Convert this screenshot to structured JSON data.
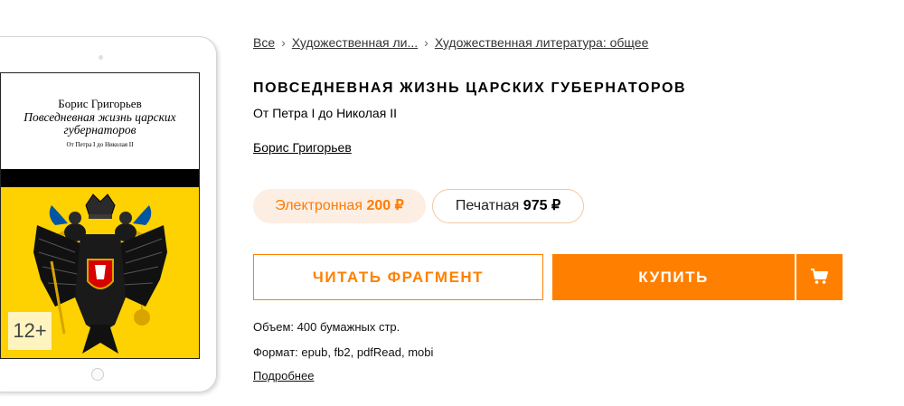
{
  "cover": {
    "author": "Борис Григорьев",
    "title": "Повседневная жизнь царских губернаторов",
    "subtitle": "От Петра I до Николая II",
    "age_rating": "12+",
    "colors": {
      "band": "#000000",
      "background": "#fed100"
    }
  },
  "breadcrumb": [
    {
      "label": "Все"
    },
    {
      "label": "Художественная ли..."
    },
    {
      "label": "Художественная литература: общее"
    }
  ],
  "book": {
    "title": "ПОВСЕДНЕВНАЯ ЖИЗНЬ ЦАРСКИХ ГУБЕРНАТОРОВ",
    "subtitle": "От Петра I до Николая II",
    "author": "Борис Григорьев"
  },
  "formats": {
    "electronic": {
      "label": "Электронная",
      "price": "200 ₽"
    },
    "print": {
      "label": "Печатная",
      "price": "975 ₽"
    }
  },
  "actions": {
    "read_fragment": "ЧИТАТЬ ФРАГМЕНТ",
    "buy": "КУПИТЬ",
    "cart_icon": "cart-icon"
  },
  "details": {
    "volume": "Объем: 400 бумажных стр.",
    "format": "Формат: epub, fb2, pdfRead, mobi",
    "more": "Подробнее"
  },
  "colors": {
    "accent": "#ff8000",
    "accent_light": "#fdeee3"
  }
}
